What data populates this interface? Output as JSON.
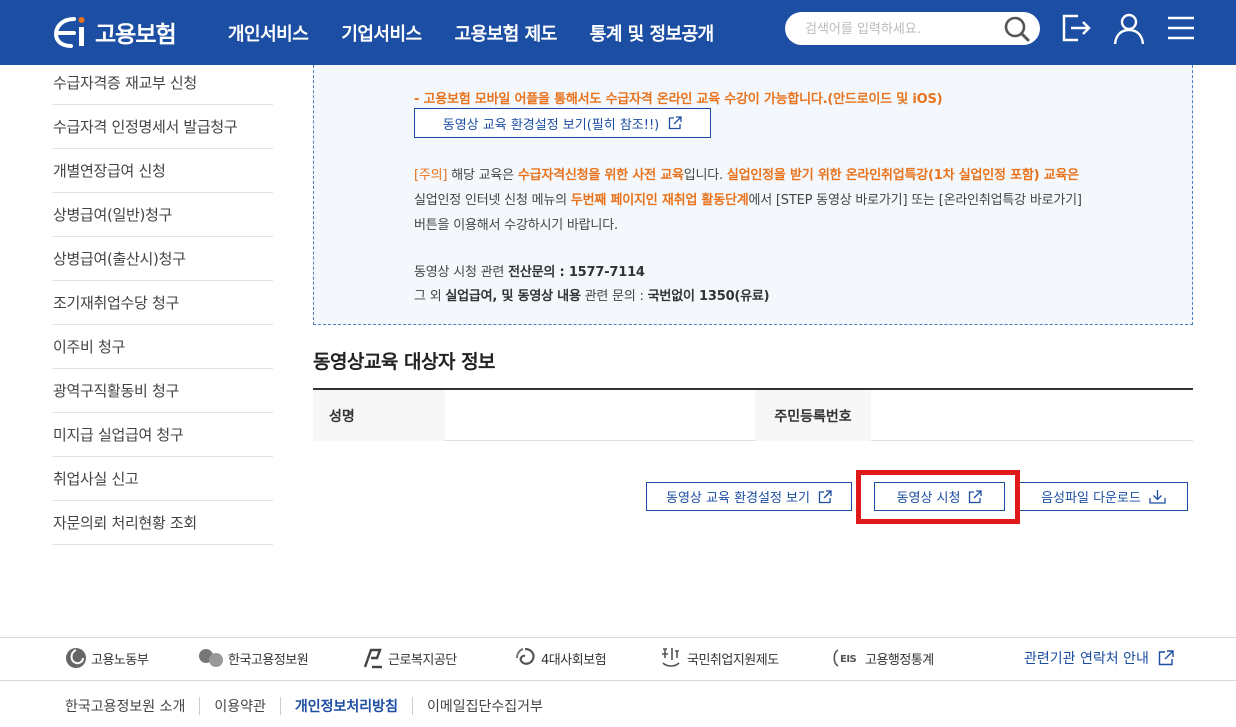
{
  "header": {
    "logo_text": "고용보험",
    "nav": [
      "개인서비스",
      "기업서비스",
      "고용보험 제도",
      "통계 및 정보공개"
    ],
    "search_placeholder": "검색어를 입력하세요."
  },
  "sidebar": {
    "items": [
      "수급자격증 재교부 신청",
      "수급자격 인정명세서 발급청구",
      "개별연장급여 신청",
      "상병급여(일반)청구",
      "상병급여(출산시)청구",
      "조기재취업수당 청구",
      "이주비 청구",
      "광역구직활동비 청구",
      "미지급 실업급여 청구",
      "취업사실 신고",
      "자문의뢰 처리현황 조회"
    ]
  },
  "notice": {
    "mobile_line": "- 고용보험 모바일 어플을 통해서도 수급자격 온라인 교육 수강이 가능합니다.(안드로이드 및 iOS)",
    "env_button": "동영상 교육 환경설정 보기(필히 참조!!)",
    "caution_tag": "[주의]",
    "caution_t1": " 해당 교육은 ",
    "caution_t2": "수급자격신청을 위한 사전 교육",
    "caution_t3": "입니다. ",
    "caution_t4": "실업인정을 받기 위한 온라인취업특강(1차 실업인정 포함) 교육은",
    "line2_t1": "실업인정 인터넷 신청 메뉴의 ",
    "line2_t2": "두번째 페이지인 재취업 활동단계",
    "line2_t3": "에서 [STEP 동영상 바로가기] 또는 [온라인취업특강 바로가기]",
    "line3": "버튼을 이용해서 수강하시기 바랍니다.",
    "contact1_t1": "동영상 시청 관련 ",
    "contact1_t2": "전산문의 : 1577-7114",
    "contact2_t1": "그 외 ",
    "contact2_t2": "실업급여, 및 동영상 내용",
    "contact2_t3": " 관련 문의 : ",
    "contact2_t4": "국번없이 1350(유료)"
  },
  "section": {
    "title": "동영상교육 대상자 정보",
    "name_label": "성명",
    "id_label": "주민등록번호"
  },
  "actions": {
    "env": "동영상 교육 환경설정 보기",
    "watch": "동영상 시청",
    "audio": "음성파일 다운로드"
  },
  "footer": {
    "orgs": [
      "고용노동부",
      "한국고용정보원",
      "근로복지공단",
      "4대사회보험",
      "국민취업지원제도",
      "고용행정통계"
    ],
    "related": "관련기관 연락처 안내",
    "links": [
      "한국고용정보원 소개",
      "이용약관",
      "개인정보처리방침",
      "이메일집단수집거부"
    ]
  },
  "colors": {
    "brand": "#1c4ea3",
    "accent_orange": "#e8731c",
    "highlight_red": "#e01a1a"
  }
}
